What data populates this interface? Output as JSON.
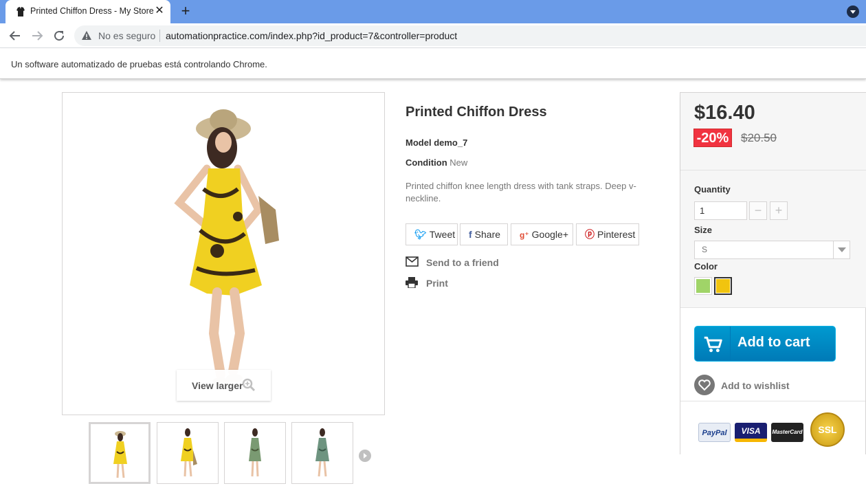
{
  "browser": {
    "tab_title": "Printed Chiffon Dress - My Store",
    "security_label": "No es seguro",
    "url": "automationpractice.com/index.php?id_product=7&controller=product",
    "infobar_text": "Un software automatizado de pruebas está controlando Chrome."
  },
  "product": {
    "name": "Printed Chiffon Dress",
    "model_label": "Model",
    "model_value": "demo_7",
    "condition_label": "Condition",
    "condition_value": "New",
    "description": "Printed chiffon knee length dress with tank straps. Deep v-neckline.",
    "view_larger": "View larger",
    "thumbnail_count": 4
  },
  "social": {
    "tweet": "Tweet",
    "share": "Share",
    "google": "Google+",
    "pinterest": "Pinterest"
  },
  "extras": {
    "send_to_friend": "Send to a friend",
    "print": "Print"
  },
  "buy": {
    "price": "$16.40",
    "discount": "-20%",
    "old_price": "$20.50",
    "quantity_label": "Quantity",
    "quantity_value": "1",
    "size_label": "Size",
    "size_value": "S",
    "color_label": "Color",
    "colors": [
      "#a0d468",
      "#f1c40f"
    ],
    "selected_color_index": 1,
    "add_to_cart": "Add to cart",
    "add_to_wishlist": "Add to wishlist"
  },
  "payments": {
    "paypal": "PayPal",
    "visa": "VISA",
    "mastercard": "MasterCard",
    "ssl": "SSL"
  },
  "colors": {
    "tabstrip": "#6a9be8",
    "discount": "#f13340",
    "cart_button": "#009ad0"
  }
}
